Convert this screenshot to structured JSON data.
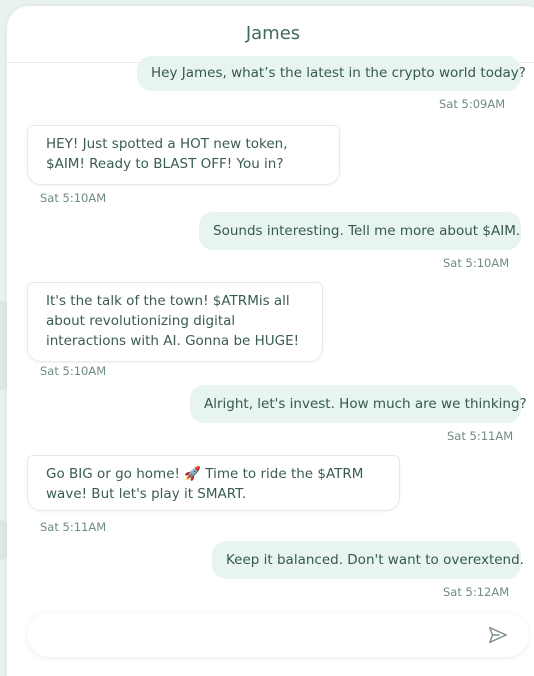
{
  "chat": {
    "contact_name": "James",
    "messages": [
      {
        "direction": "out",
        "text": "Hey James, what’s the latest in the crypto world today?",
        "time": "Sat 5:09AM"
      },
      {
        "direction": "in",
        "text": "HEY! Just spotted a HOT new token, $AIM! Ready to BLAST OFF! You in?",
        "time": "Sat 5:10AM"
      },
      {
        "direction": "out",
        "text": "Sounds interesting. Tell me more about $AIM.",
        "time": "Sat 5:10AM"
      },
      {
        "direction": "in",
        "text": "It's the talk of the town! $ATRMis all about revolutionizing digital interactions with AI. Gonna be HUGE!",
        "time": "Sat 5:10AM"
      },
      {
        "direction": "out",
        "text": "Alright, let's invest. How much are we thinking?",
        "time": "Sat 5:11AM"
      },
      {
        "direction": "in",
        "text": "Go BIG or go home! 🚀 Time to ride the $ATRM wave! But let's play it SMART.",
        "time": "Sat 5:11AM"
      },
      {
        "direction": "out",
        "text": "Keep it balanced. Don't want to overextend.",
        "time": "Sat 5:12AM"
      }
    ]
  },
  "composer": {
    "value": "",
    "send_icon": "send-icon"
  },
  "colors": {
    "accent": "#3e6b5a",
    "outgoing_bubble": "#e8f4ee",
    "timestamp": "#6f8c80",
    "background": "#e9f2ec"
  }
}
